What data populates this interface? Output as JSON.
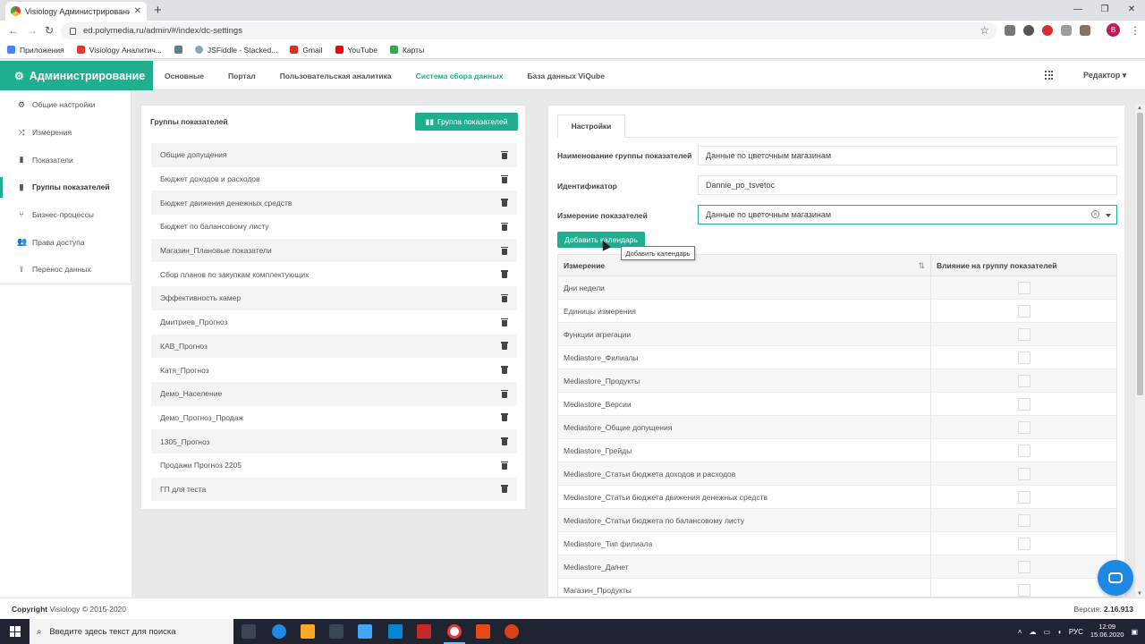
{
  "browser": {
    "tab_title": "Visiology Администрирование",
    "tab_close": "✕",
    "new_tab": "+",
    "url": "ed.polymedia.ru/admin/#/index/dc-settings",
    "profile_initial": "B",
    "bookmarks": [
      {
        "label": "Приложения",
        "color": "#4285f4"
      },
      {
        "label": "Visiology Аналитич...",
        "color": "#e53935"
      },
      {
        "label": "",
        "color": "#607d8b"
      },
      {
        "label": "JSFiddle - Stacked...",
        "color": "#90a4ae"
      },
      {
        "label": "Gmail",
        "color": "#d93025"
      },
      {
        "label": "YouTube",
        "color": "#ff0000"
      },
      {
        "label": "Карты",
        "color": "#34a853"
      }
    ]
  },
  "header": {
    "brand": "Администрирование",
    "nav": [
      "Основные",
      "Портал",
      "Пользовательская аналитика",
      "Система сбора данных",
      "База данных ViQube"
    ],
    "active_nav": 3,
    "editor_menu": "Редактор ▾",
    "accent": "#1fae8e"
  },
  "sidebar": {
    "items": [
      {
        "label": "Общие настройки",
        "icon": "⚙"
      },
      {
        "label": "Измерения",
        "icon": "⤨"
      },
      {
        "label": "Показатели",
        "icon": "▮"
      },
      {
        "label": "Группы показателей",
        "icon": "▮"
      },
      {
        "label": "Бизнес-процессы",
        "icon": "⑂"
      },
      {
        "label": "Права доступа",
        "icon": "👥"
      },
      {
        "label": "Перенос данных",
        "icon": "⇪"
      }
    ],
    "active": 3
  },
  "groups": {
    "title": "Группы показателей",
    "add_button": "Группа показателей",
    "items": [
      "Общие допущения",
      "Бюджет доходов и расходов",
      "Бюджет движения денежных средств",
      "Бюджет по балансовому листу",
      "Магазин_Плановые показатели",
      "Сбор планов по закупкам комплектующих",
      "Эффективность камер",
      "Дмитриев_Прогноз",
      "КАВ_Прогноз",
      "Катя_Прогноз",
      "Демо_Население",
      "Демо_Прогноз_Продаж",
      "1305_Прогноз",
      "Продажи Прогноз 2205",
      "ГП для теста"
    ]
  },
  "settings": {
    "tab": "Настройки",
    "name_label": "Наименование группы показателей",
    "name_value": "Данные по цветочным магазинам",
    "id_label": "Идентификатор",
    "id_value": "Dannie_po_tsvetoc",
    "dimension_label": "Измерение показателей",
    "dimension_value": "Данные по цветочным магазинам",
    "add_calendar_button": "Добавить календарь",
    "tooltip": "Добавить календарь",
    "table": {
      "col_dimension": "Измерение",
      "col_influence": "Влияние на группу показателей",
      "rows": [
        "Дни недели",
        "Единицы измерения",
        "Функции агрегации",
        "Mediastore_Филиалы",
        "Mediastore_Продукты",
        "Mediastore_Версии",
        "Mediastore_Общие допущения",
        "Mediastore_Грейды",
        "Mediastore_Статьи бюджета доходов и расходов",
        "Mediastore_Статьи бюджета движения денежных средств",
        "Mediastore_Статьи бюджета по балансовому листу",
        "Mediastore_Тип филиала",
        "Mediastore_Да/нет",
        "Магазин_Продукты"
      ]
    }
  },
  "footer": {
    "copyright_bold": "Copyright",
    "copyright_rest": "Visiology © 2015-2020",
    "version_label": "Версия:",
    "version_value": "2.16.913"
  },
  "taskbar": {
    "search_placeholder": "Введите здесь текст для поиска",
    "lang": "РУС",
    "time": "12:09",
    "date": "15.06.2020"
  }
}
